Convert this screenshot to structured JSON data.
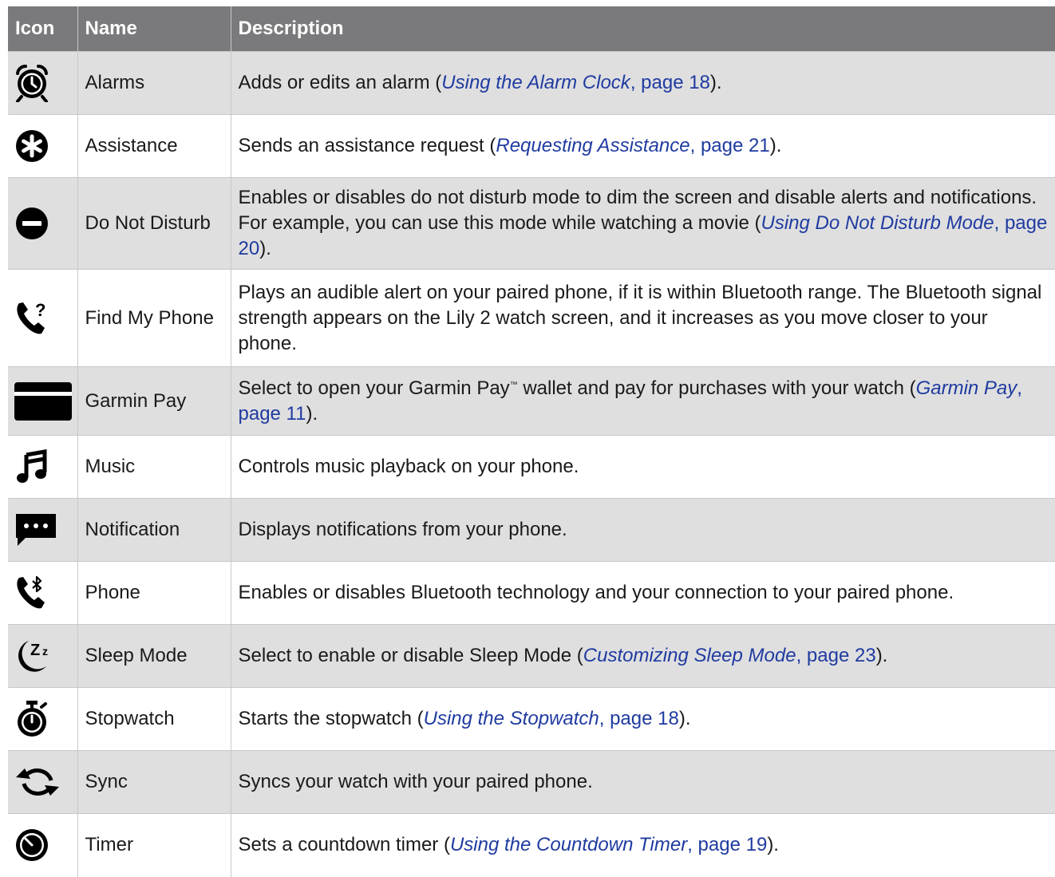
{
  "headers": {
    "icon": "Icon",
    "name": "Name",
    "description": "Description"
  },
  "rows": [
    {
      "icon": "alarm-clock-icon",
      "name": "Alarms",
      "desc_pre": "Adds or edits an alarm (",
      "link_title": "Using the Alarm Clock",
      "link_page": ", page 18",
      "desc_post": ")."
    },
    {
      "icon": "asterisk-circle-icon",
      "name": "Assistance",
      "desc_pre": "Sends an assistance request (",
      "link_title": "Requesting Assistance",
      "link_page": ", page 21",
      "desc_post": ")."
    },
    {
      "icon": "do-not-disturb-icon",
      "name": "Do Not Disturb",
      "desc_pre": "Enables or disables do not disturb mode to dim the screen and disable alerts and notifications. For example, you can use this mode while watching a movie (",
      "link_title": "Using Do Not Disturb Mode",
      "link_page": ", page 20",
      "desc_post": ")."
    },
    {
      "icon": "find-phone-icon",
      "name": "Find My Phone",
      "desc_pre": "Plays an audible alert on your paired phone, if it is within Bluetooth range. The Bluetooth signal strength appears on the Lily 2 watch screen, and it increases as you move closer to your phone."
    },
    {
      "icon": "payment-card-icon",
      "name": "Garmin Pay",
      "desc_pre": "Select to open your Garmin Pay",
      "trademark": "™",
      "desc_mid": " wallet and pay for purchases with your watch (",
      "link_title": "Garmin Pay",
      "link_page": ", page 11",
      "desc_post": ")."
    },
    {
      "icon": "music-note-icon",
      "name": "Music",
      "desc_pre": "Controls music playback on your phone."
    },
    {
      "icon": "notification-bubble-icon",
      "name": "Notification",
      "desc_pre": "Displays notifications from your phone."
    },
    {
      "icon": "phone-bluetooth-icon",
      "name": "Phone",
      "desc_pre": "Enables or disables Bluetooth technology and your connection to your paired phone."
    },
    {
      "icon": "sleep-moon-icon",
      "name": "Sleep Mode",
      "desc_pre": "Select to enable or disable Sleep Mode (",
      "link_title": "Customizing Sleep Mode",
      "link_page": ", page 23",
      "desc_post": ")."
    },
    {
      "icon": "stopwatch-icon",
      "name": "Stopwatch",
      "desc_pre": "Starts the stopwatch (",
      "link_title": "Using the Stopwatch",
      "link_page": ", page 18",
      "desc_post": ")."
    },
    {
      "icon": "sync-arrows-icon",
      "name": "Sync",
      "desc_pre": "Syncs your watch with your paired phone."
    },
    {
      "icon": "timer-icon",
      "name": "Timer",
      "desc_pre": "Sets a countdown timer (",
      "link_title": "Using the Countdown Timer",
      "link_page": ", page 19",
      "desc_post": ")."
    }
  ]
}
